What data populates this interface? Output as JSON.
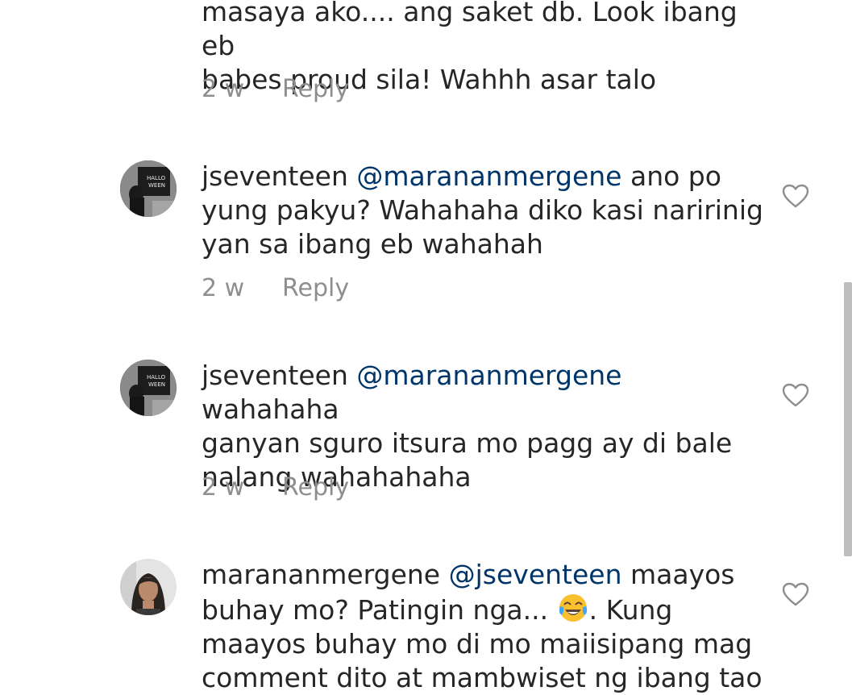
{
  "top_comment": {
    "text_line1": "masaya ako.... ang saket db. Look ibang eb",
    "text_line2": "babes proud sila! Wahhh asar talo",
    "time": "2 w",
    "reply_label": "Reply"
  },
  "comments": [
    {
      "username": "jseventeen",
      "mention": "@marananmergene",
      "text_first": " ano po",
      "text_rest": "yung pakyu? Wahahaha diko kasi naririnig\nyan sa ibang eb wahahah",
      "time": "2 w",
      "reply_label": "Reply",
      "avatar_icon": "halloween-avatar",
      "like_icon": "heart-outline-icon"
    },
    {
      "username": "jseventeen",
      "mention": "@marananmergene",
      "text_first": " wahahaha",
      "text_rest": "ganyan sguro itsura mo pagg ay di bale\nnalang wahahahaha",
      "time": "2 w",
      "reply_label": "Reply",
      "avatar_icon": "halloween-avatar",
      "like_icon": "heart-outline-icon"
    },
    {
      "username": "marananmergene",
      "mention": "@jseventeen",
      "text_first": " maayos",
      "text_line2_a": "buhay mo? Patingin nga... ",
      "emoji": "face-with-tears-of-joy-emoji",
      "text_line2_b": ". Kung",
      "text_line3": "maayos buhay mo di mo maiisipang mag",
      "text_line4": "comment dito at mambwiset ng ibang tao",
      "avatar_icon": "girl-portrait-avatar",
      "like_icon": "heart-outline-icon"
    }
  ],
  "colors": {
    "text": "#262626",
    "mention": "#003569",
    "meta": "#8e8e8e",
    "scrollbar": "#bdbdbd"
  }
}
